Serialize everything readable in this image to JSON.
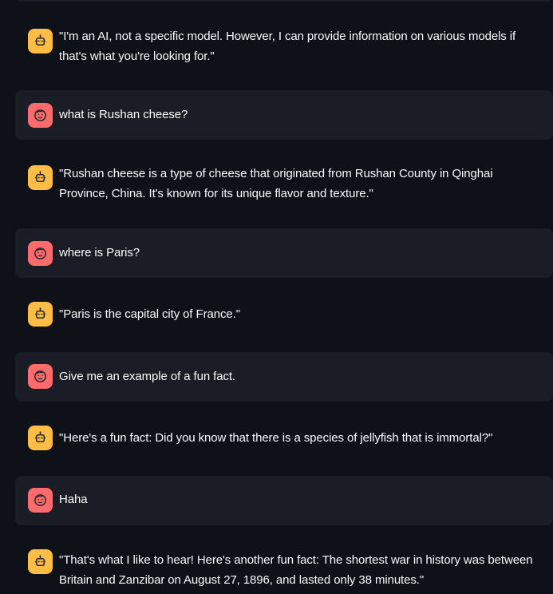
{
  "messages": [
    {
      "role": "assistant",
      "avatar_icon": "robot-face-icon",
      "text": "\"I'm an AI, not a specific model. However, I can provide information on various models if that's what you're looking for.\""
    },
    {
      "role": "user",
      "avatar_icon": "smiling-face-icon",
      "text": "what is Rushan cheese?"
    },
    {
      "role": "assistant",
      "avatar_icon": "robot-face-icon",
      "text": "\"Rushan cheese is a type of cheese that originated from Rushan County in Qinghai Province, China. It's known for its unique flavor and texture.\""
    },
    {
      "role": "user",
      "avatar_icon": "smiling-face-icon",
      "text": "where is Paris?"
    },
    {
      "role": "assistant",
      "avatar_icon": "robot-face-icon",
      "text": "\"Paris is the capital city of France.\""
    },
    {
      "role": "user",
      "avatar_icon": "smiling-face-icon",
      "text": "Give me an example of a fun fact."
    },
    {
      "role": "assistant",
      "avatar_icon": "robot-face-icon",
      "text": "\"Here's a fun fact: Did you know that there is a species of jellyfish that is immortal?\""
    },
    {
      "role": "user",
      "avatar_icon": "smiling-face-icon",
      "text": "Haha"
    },
    {
      "role": "assistant",
      "avatar_icon": "robot-face-icon",
      "text": "\"That's what I like to hear! Here's another fun fact: The shortest war in history was between Britain and Zanzibar on August 27, 1896, and lasted only 38 minutes.\""
    }
  ],
  "colors": {
    "background": "#0e1117",
    "user_message_background": "#1a1d25",
    "assistant_avatar": "#ffbd45",
    "user_avatar": "#ff6b6b",
    "text": "#fafafa"
  }
}
